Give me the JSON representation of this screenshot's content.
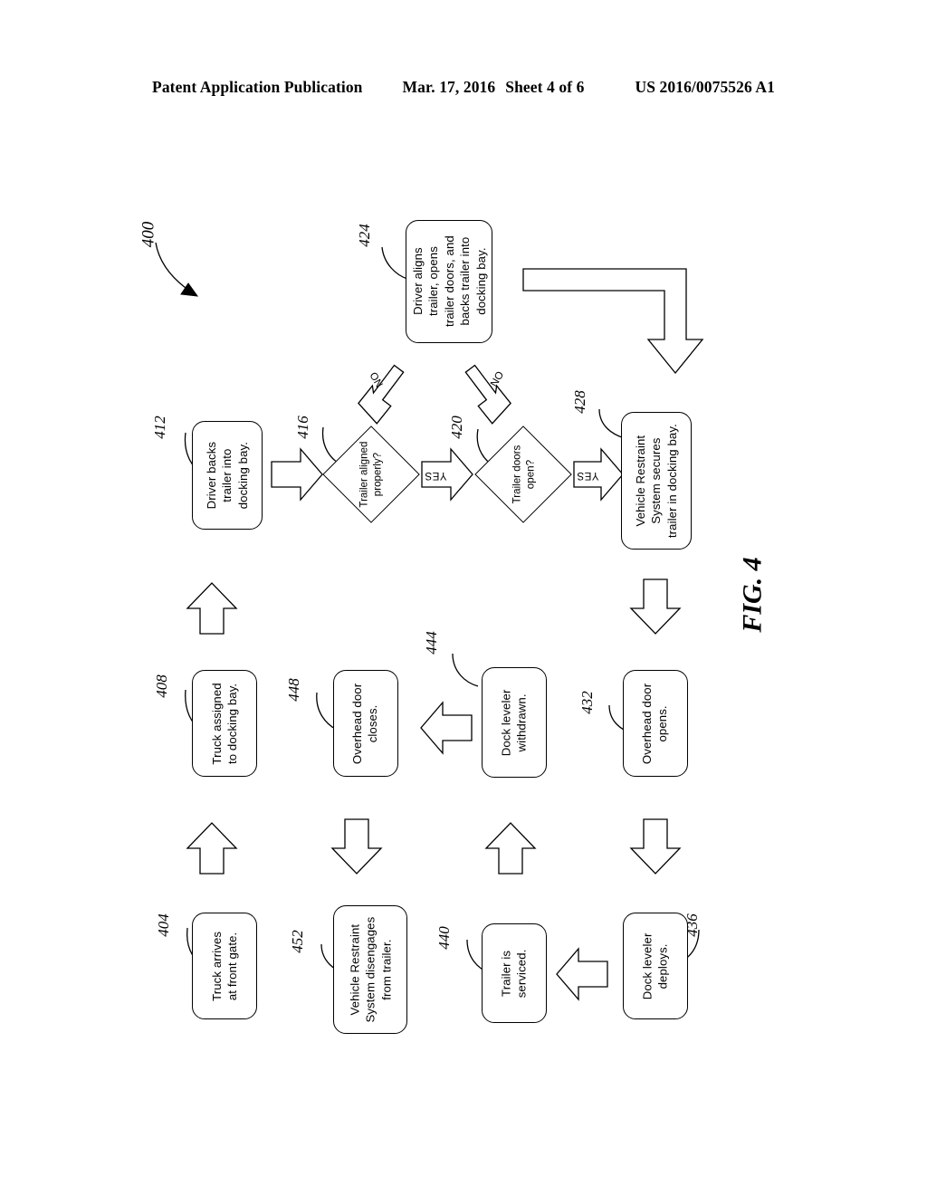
{
  "header": {
    "publication": "Patent Application Publication",
    "date": "Mar. 17, 2016",
    "sheet": "Sheet 4 of 6",
    "patent_number": "US 2016/0075526 A1"
  },
  "figure": {
    "caption": "FIG. 4",
    "diagram_reference": "400"
  },
  "flowchart": {
    "type": "process-flow",
    "orientation": "rotated-90-ccw",
    "nodes": [
      {
        "id": "404",
        "ref": "404",
        "shape": "rounded-rect",
        "text": "Truck arrives\nat front gate."
      },
      {
        "id": "408",
        "ref": "408",
        "shape": "rounded-rect",
        "text": "Truck assigned\nto docking bay."
      },
      {
        "id": "412",
        "ref": "412",
        "shape": "rounded-rect",
        "text": "Driver backs\ntrailer into\ndocking bay."
      },
      {
        "id": "416",
        "ref": "416",
        "shape": "diamond",
        "text": "Trailer aligned\nproperly?"
      },
      {
        "id": "420",
        "ref": "420",
        "shape": "diamond",
        "text": "Trailer doors\nopen?"
      },
      {
        "id": "424",
        "ref": "424",
        "shape": "rounded-rect",
        "text": "Driver aligns\ntrailer, opens\ntrailer doors, and\nbacks trailer into\ndocking bay."
      },
      {
        "id": "428",
        "ref": "428",
        "shape": "rounded-rect",
        "text": "Vehicle Restraint\nSystem secures\ntrailer in docking bay."
      },
      {
        "id": "432",
        "ref": "432",
        "shape": "rounded-rect",
        "text": "Overhead door\nopens."
      },
      {
        "id": "436",
        "ref": "436",
        "shape": "rounded-rect",
        "text": "Dock leveler\ndeploys."
      },
      {
        "id": "440",
        "ref": "440",
        "shape": "rounded-rect",
        "text": "Trailer is\nserviced."
      },
      {
        "id": "444",
        "ref": "444",
        "shape": "rounded-rect",
        "text": "Dock leveler\nwithdrawn."
      },
      {
        "id": "448",
        "ref": "448",
        "shape": "rounded-rect",
        "text": "Overhead door\ncloses."
      },
      {
        "id": "452",
        "ref": "452",
        "shape": "rounded-rect",
        "text": "Vehicle Restraint\nSystem disengages\nfrom trailer."
      }
    ],
    "edge_labels": {
      "yes_1": "YES",
      "yes_2": "YES",
      "no_1": "NO",
      "no_2": "NO"
    },
    "edges": [
      {
        "from": "404",
        "to": "408",
        "label": ""
      },
      {
        "from": "408",
        "to": "412",
        "label": ""
      },
      {
        "from": "412",
        "to": "416",
        "label": ""
      },
      {
        "from": "416",
        "to": "420",
        "label": "YES"
      },
      {
        "from": "416",
        "to": "424",
        "label": "NO"
      },
      {
        "from": "420",
        "to": "428",
        "label": "YES"
      },
      {
        "from": "420",
        "to": "424",
        "label": "NO"
      },
      {
        "from": "424",
        "to": "428",
        "label": ""
      },
      {
        "from": "428",
        "to": "432",
        "label": ""
      },
      {
        "from": "432",
        "to": "436",
        "label": ""
      },
      {
        "from": "436",
        "to": "440",
        "label": ""
      },
      {
        "from": "440",
        "to": "444",
        "label": ""
      },
      {
        "from": "444",
        "to": "448",
        "label": ""
      },
      {
        "from": "448",
        "to": "452",
        "label": ""
      }
    ]
  }
}
